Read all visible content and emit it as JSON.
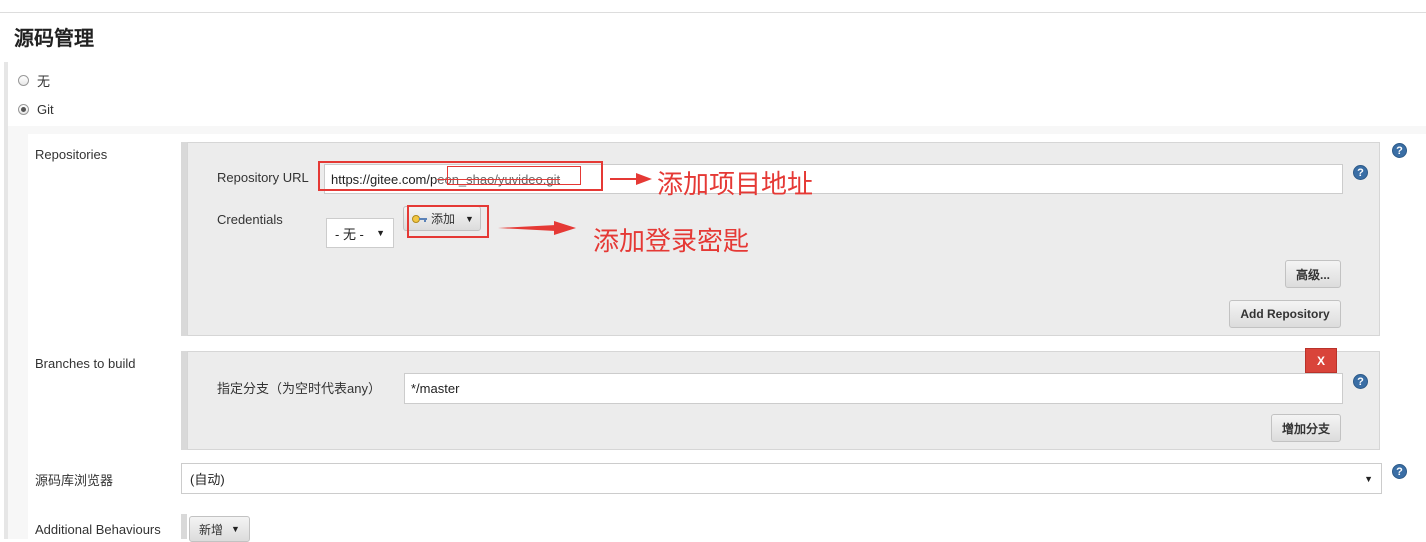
{
  "section": {
    "title": "源码管理"
  },
  "scm_options": [
    {
      "label": "无",
      "checked": false
    },
    {
      "label": "Git",
      "checked": true
    }
  ],
  "repositories": {
    "label": "Repositories",
    "url_label": "Repository URL",
    "url_value": "https://gitee.com/p",
    "url_redacted_text": "eon_shao/yuvideo.git",
    "credentials_label": "Credentials",
    "credentials_select": "- 无 -",
    "add_button": "添加",
    "advanced_button": "高级...",
    "add_repository_button": "Add Repository"
  },
  "branches": {
    "label": "Branches to build",
    "branch_label": "指定分支（为空时代表any）",
    "branch_value": "*/master",
    "delete_button": "X",
    "add_branch_button": "增加分支"
  },
  "browser": {
    "label": "源码库浏览器",
    "value": "(自动)"
  },
  "behaviours": {
    "label": "Additional Behaviours",
    "add_button": "新增"
  },
  "help_icon_text": "?",
  "annotations": {
    "url_note": "添加项目地址",
    "cred_note": "添加登录密匙"
  },
  "colors": {
    "annotation": "#e53935",
    "help": "#3a6ea5",
    "delete": "#d9443a"
  }
}
